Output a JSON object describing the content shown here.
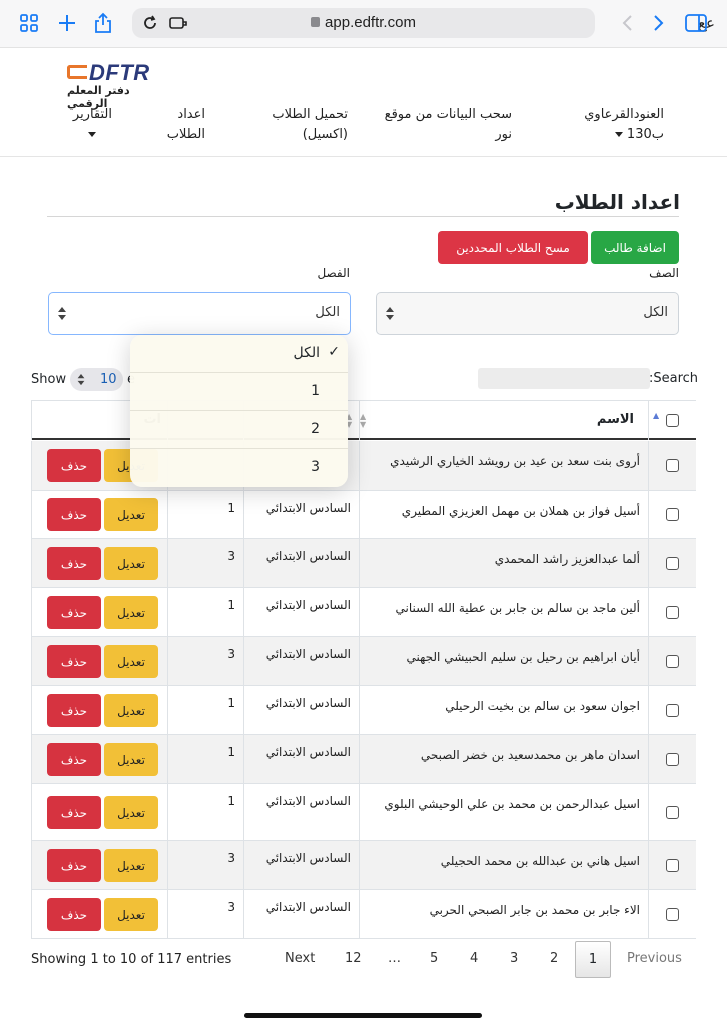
{
  "browser": {
    "url": "app.edftr.com",
    "reader_label": "عع",
    "accent_color": "#1a7cf5"
  },
  "logo": {
    "brand": "DFTR",
    "subtitle": "دفتر المعلم الرقمي"
  },
  "nav": {
    "user_line1": "العنودالقرعاوي",
    "user_line2": "ب130",
    "noor_line1": "سحب البيانات من موقع",
    "noor_line2": "نور",
    "excel_line1": "تحميل الطلاب",
    "excel_line2": "(اكسيل)",
    "students_line1": "اعداد",
    "students_line2": "الطلاب",
    "reports": "التقارير"
  },
  "page": {
    "title": "اعداد الطلاب",
    "add_student": "اضافة طالب",
    "delete_selected": "مسح الطلاب المحددين"
  },
  "filters": {
    "grade_label": "الصف",
    "grade_value": "الكل",
    "class_label": "الفصل",
    "class_value": "الكل",
    "class_options": [
      {
        "label": "الكل",
        "selected": true
      },
      {
        "label": "1",
        "selected": false
      },
      {
        "label": "2",
        "selected": false
      },
      {
        "label": "3",
        "selected": false
      }
    ]
  },
  "table_controls": {
    "show_label": "Show",
    "length_value": "10",
    "entries_fragment": "e",
    "search_label": ":Search"
  },
  "table": {
    "headers": {
      "name": "الاسم",
      "actions_fragment": "ات"
    },
    "edit_label": "تعديل",
    "delete_label": "حذف",
    "rows": [
      {
        "name": "أروى بنت سعد بن عيد بن رويشد الخياري الرشيدي",
        "grade": "",
        "class": ""
      },
      {
        "name": "أسيل فواز بن هملان بن مهمل العزيزي المطيري",
        "grade": "السادس الابتدائي",
        "class": "1"
      },
      {
        "name": "ألما عبدالعزيز راشد المحمدي",
        "grade": "السادس الابتدائي",
        "class": "3"
      },
      {
        "name": "ألين ماجد بن سالم بن جابر بن عطية الله السناني",
        "grade": "السادس الابتدائي",
        "class": "1"
      },
      {
        "name": "أيان ابراهيم بن رحيل بن سليم الحبيشي الجهني",
        "grade": "السادس الابتدائي",
        "class": "3"
      },
      {
        "name": "اجوان سعود بن سالم بن بخيت الرحيلي",
        "grade": "السادس الابتدائي",
        "class": "1"
      },
      {
        "name": "اسدان ماهر بن محمدسعيد بن خضر الصبحي",
        "grade": "السادس الابتدائي",
        "class": "1"
      },
      {
        "name": "اسيل عبدالرحمن بن محمد بن علي الوحيشي البلوي",
        "grade": "السادس الابتدائي",
        "class": "1"
      },
      {
        "name": "اسيل هاني بن عبدالله بن محمد الحجيلي",
        "grade": "السادس الابتدائي",
        "class": "3"
      },
      {
        "name": "الاء جابر بن محمد بن جابر الصبحي الحربي",
        "grade": "السادس الابتدائي",
        "class": "3"
      }
    ]
  },
  "footer": {
    "showing": "Showing 1 to 10 of 117 entries",
    "pagination": {
      "next": "Next",
      "previous": "Previous",
      "ellipsis": "…",
      "pages": [
        "12",
        "5",
        "4",
        "3",
        "2",
        "1"
      ],
      "active": "1"
    }
  },
  "colors": {
    "success": "#28a745",
    "danger": "#dc3545",
    "warning": "#f2c037",
    "brand_orange": "#e8762b",
    "brand_navy": "#2b3a7a"
  }
}
